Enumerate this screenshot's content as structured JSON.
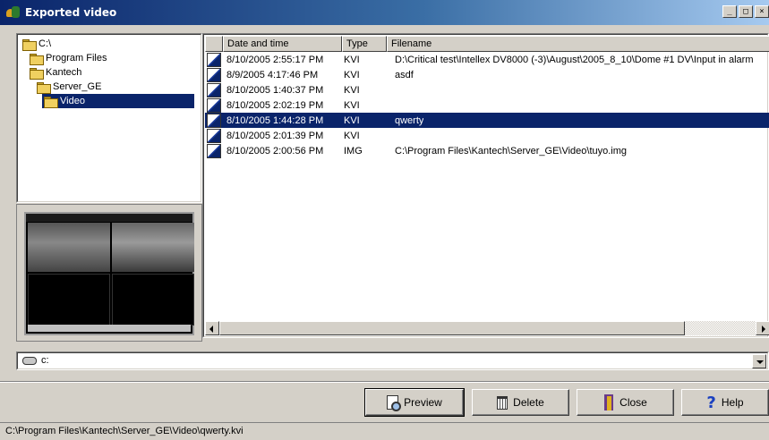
{
  "window": {
    "title": "Exported video",
    "min_glyph": "_",
    "max_glyph": "□",
    "close_glyph": "×"
  },
  "tree": [
    {
      "label": "C:\\",
      "depth": 0,
      "selected": false
    },
    {
      "label": "Program Files",
      "depth": 1,
      "selected": false
    },
    {
      "label": "Kantech",
      "depth": 1,
      "selected": false
    },
    {
      "label": "Server_GE",
      "depth": 2,
      "selected": false
    },
    {
      "label": "Video",
      "depth": 3,
      "selected": true
    }
  ],
  "list": {
    "columns": [
      "Date and time",
      "Type",
      "Filename"
    ],
    "rows": [
      {
        "date": "8/10/2005 2:55:17 PM",
        "type": "KVI",
        "file": "D:\\Critical test\\Intellex DV8000 (-3)\\August\\2005_8_10\\Dome #1 DV\\Input in alarm",
        "selected": false
      },
      {
        "date": "8/9/2005 4:17:46 PM",
        "type": "KVI",
        "file": "asdf",
        "selected": false
      },
      {
        "date": "8/10/2005 1:40:37 PM",
        "type": "KVI",
        "file": "",
        "selected": false
      },
      {
        "date": "8/10/2005 2:02:19 PM",
        "type": "KVI",
        "file": "",
        "selected": false
      },
      {
        "date": "8/10/2005 1:44:28 PM",
        "type": "KVI",
        "file": "qwerty",
        "selected": true
      },
      {
        "date": "8/10/2005 2:01:39 PM",
        "type": "KVI",
        "file": "",
        "selected": false
      },
      {
        "date": "8/10/2005 2:00:56 PM",
        "type": "IMG",
        "file": "C:\\Program Files\\Kantech\\Server_GE\\Video\\tuyo.img",
        "selected": false
      }
    ]
  },
  "drive": {
    "value": "c:"
  },
  "buttons": {
    "preview": "Preview",
    "delete": "Delete",
    "close": "Close",
    "help": "Help",
    "help_glyph": "?"
  },
  "status": "C:\\Program Files\\Kantech\\Server_GE\\Video\\qwerty.kvi",
  "colors": {
    "selection": "#0a246a",
    "face": "#d4d0c8"
  }
}
